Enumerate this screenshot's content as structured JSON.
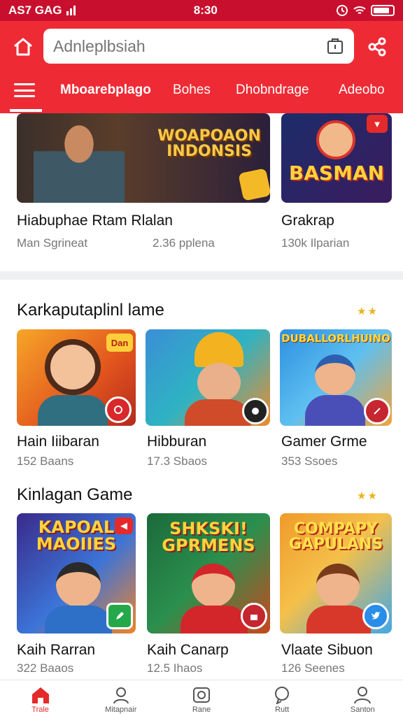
{
  "status_bar": {
    "carrier": "AS7 GAG",
    "time": "8:30"
  },
  "search": {
    "placeholder": "Adnleplbsiah"
  },
  "tabs": [
    {
      "label": "Mboarebplago",
      "active": true
    },
    {
      "label": "Bohes",
      "active": false
    },
    {
      "label": "Dhobndrage",
      "active": false
    },
    {
      "label": "Adeobo",
      "active": false
    }
  ],
  "featured": [
    {
      "art_text": "WOAPOAON\nINDONSIS",
      "title": "Hiabuphae Rtam Rlalan",
      "meta_left": "Man Sgrineat",
      "meta_right": "2.36 pplena"
    },
    {
      "art_text": "BASMAN",
      "title": "Grakrap",
      "meta_left": "130k Ilparian"
    }
  ],
  "section1": {
    "title": "Karkaputaplinl lame",
    "stars": "★★",
    "items": [
      {
        "title": "Hain Iiibaran",
        "meta": "152 Baans",
        "badge": "Dan"
      },
      {
        "title": "Hibburan",
        "meta": "17.3 Sbaos"
      },
      {
        "title": "Gamer Grme",
        "meta": "353 Ssoes",
        "art_text": "DUBALLORLHUINO"
      }
    ]
  },
  "section2": {
    "title": "Kinlagan Game",
    "stars": "★★",
    "items": [
      {
        "title": "Kaih Rarran",
        "meta": "322 Baaos",
        "art_text": "KAPOAL\nMAOIIES"
      },
      {
        "title": "Kaih Canarp",
        "meta": "12.5 Ihaos",
        "art_text": "SHKSKI!\nGPRMENS"
      },
      {
        "title": "Vlaate Sibuon",
        "meta": "126 Seenes",
        "art_text": "COMPAPY\nGAPULANS"
      }
    ]
  },
  "bottom_nav": [
    {
      "label": "Trale",
      "icon": "home-icon",
      "active": true
    },
    {
      "label": "Mitapnair",
      "icon": "profile-icon",
      "active": false
    },
    {
      "label": "Rane",
      "icon": "camera-icon",
      "active": false
    },
    {
      "label": "Rutt",
      "icon": "chat-icon",
      "active": false
    },
    {
      "label": "Santon",
      "icon": "user-icon",
      "active": false
    }
  ],
  "colors": {
    "brand_red": "#ee2b35",
    "status_red": "#c8102e",
    "star_gold": "#e8b418"
  }
}
